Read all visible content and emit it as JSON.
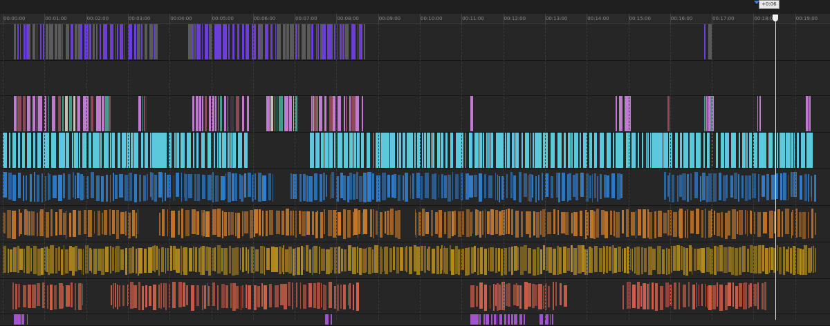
{
  "timecodes": [
    "00:00:00",
    "00:01:00",
    "00:02:00",
    "00:03:00",
    "00:04:00",
    "00:05:00",
    "00:06:00",
    "00:07:00",
    "00:08:00",
    "00:09:00",
    "00:10:00",
    "00:11:00",
    "00:12:00",
    "00:13:00",
    "00:14:00",
    "00:15:00",
    "00:16:00",
    "00:17:00",
    "00:18:00",
    "00:19:00"
  ],
  "playhead": {
    "offset_label": "+0:06"
  },
  "colors": {
    "background": "#262626",
    "video_purple": "#6b3fd6",
    "video_checker": "#5a5a5a",
    "video_thumb_pink": "#c07bd0",
    "video_cyan": "#5bc8dc",
    "audio_blue": "#2f7fd0",
    "audio_orange": "#c97a2a",
    "audio_gold": "#b48c1e",
    "audio_red": "#d0604a",
    "video_magenta": "#a055c8"
  },
  "tracks": [
    {
      "name": "video-track-v5",
      "kind": "video",
      "color": "#6b3fd6",
      "icon": "film-strip"
    },
    {
      "name": "video-track-v4",
      "kind": "video",
      "color": "#262626",
      "icon": "film-strip"
    },
    {
      "name": "video-track-v3",
      "kind": "video",
      "color": "#c07bd0",
      "icon": "film-strip"
    },
    {
      "name": "video-track-v2",
      "kind": "video",
      "color": "#5bc8dc",
      "icon": "film-strip"
    },
    {
      "name": "audio-track-a1",
      "kind": "audio",
      "color": "#2f7fd0",
      "icon": "waveform"
    },
    {
      "name": "audio-track-a2",
      "kind": "audio",
      "color": "#c97a2a",
      "icon": "waveform"
    },
    {
      "name": "audio-track-a3",
      "kind": "audio",
      "color": "#b48c1e",
      "icon": "waveform"
    },
    {
      "name": "audio-track-a4",
      "kind": "audio",
      "color": "#d0604a",
      "icon": "waveform"
    },
    {
      "name": "video-track-v1",
      "kind": "video",
      "color": "#a055c8",
      "icon": "film-strip"
    }
  ]
}
